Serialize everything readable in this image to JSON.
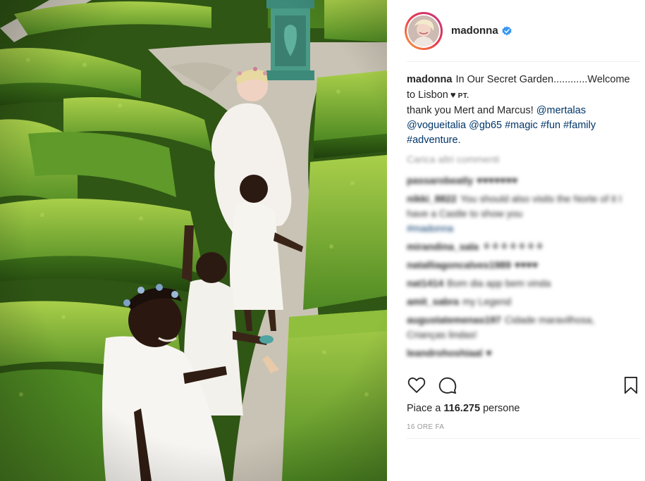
{
  "post": {
    "username": "madonna",
    "verified_icon": "verified-badge-icon",
    "accent_color": "#3897f0",
    "caption": {
      "username": "madonna",
      "text_line1": "In Our Secret Garden............Welcome to Lisbon",
      "heart": "♥",
      "country_code": "PT.",
      "text_line2": "thank you Mert and Marcus!",
      "mentions": [
        "@mertalas",
        "@vogueitalia",
        "@gb65"
      ],
      "hashtags": [
        "#magic",
        "#fun",
        "#family",
        "#adventure."
      ]
    },
    "more_comments_label": "Carica altri commenti",
    "comments": [
      {
        "user": "passarobeatly",
        "text": "♥♥♥♥♥♥♥"
      },
      {
        "user": "nikki_8822",
        "text": "You should also visits the Norte of it I have a Castle to show you",
        "tag": "#madonna"
      },
      {
        "user": "mirandina_sala",
        "text": "⚘⚘⚘⚘⚘⚘⚘"
      },
      {
        "user": "natalliagoncalves1989",
        "text": "♥♥♥♥"
      },
      {
        "user": "nat1414",
        "text": "Bom dia app bem vinda"
      },
      {
        "user": "amit_sabra",
        "text": "my Legend"
      },
      {
        "user": "augustatemenas197",
        "text": "Cidade maravilhosa, Crianças lindas!"
      },
      {
        "user": "leandrohoshiaal",
        "text": "♥"
      }
    ],
    "actions": {
      "like_icon": "heart-outline-icon",
      "comment_icon": "comment-bubble-icon",
      "save_icon": "bookmark-icon"
    },
    "likes_prefix": "Piace a",
    "likes_count": "116.275",
    "likes_suffix": "persone",
    "timestamp": "16 ORE FA"
  }
}
